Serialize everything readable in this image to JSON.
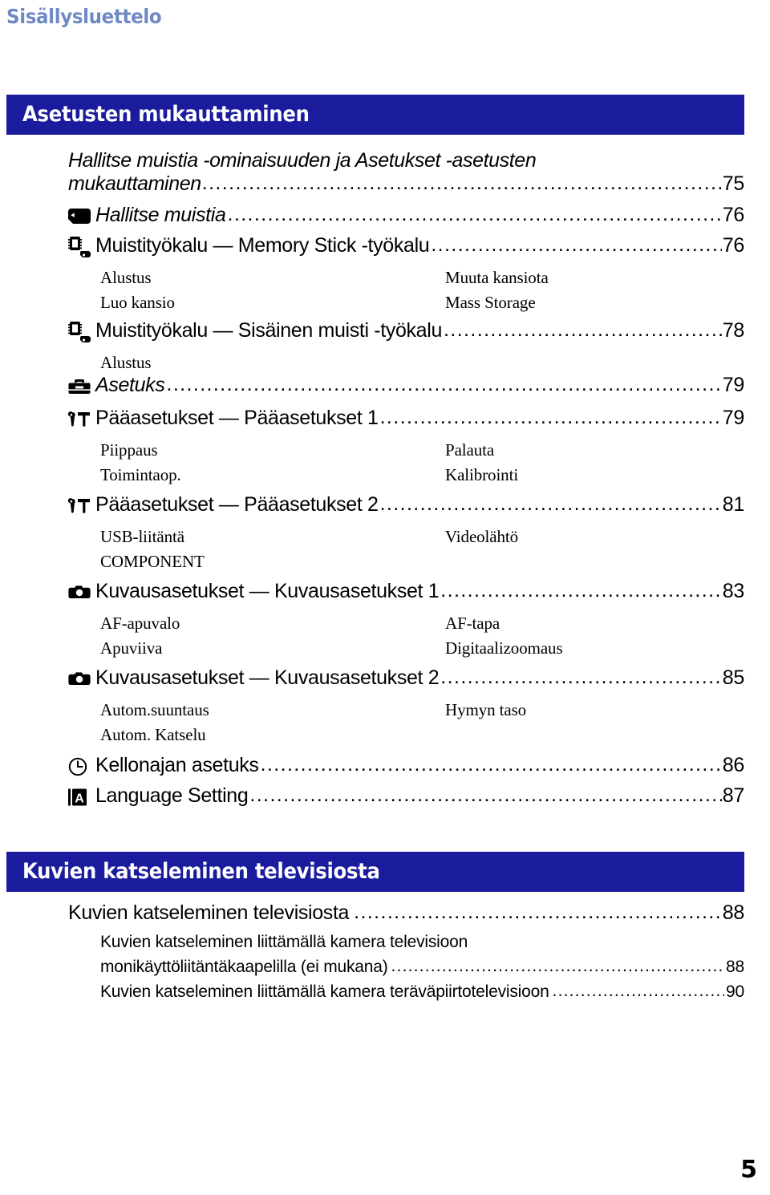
{
  "running_head": "Sisällysluettelo",
  "folio": "5",
  "colors": {
    "banner_blue": "#1b1b9e",
    "running_head_blue": "#7089c4",
    "text": "#000000"
  },
  "sections": [
    {
      "banner": "Asetusten mukauttaminen",
      "entries": [
        {
          "icon": "none",
          "label_line1": "Hallitse muistia -ominaisuuden ja Asetukset -asetusten",
          "label_line2": "mukauttaminen",
          "page": "75",
          "style": "italic"
        },
        {
          "icon": "memory-stick-icon",
          "label": "Hallitse muistia",
          "page": "76",
          "style": "italic"
        },
        {
          "icon": "memory-stick-tool-icon",
          "label": "Muistityökalu — Memory Stick -työkalu",
          "page": "76",
          "style": "regular",
          "subitems": [
            {
              "left": "Alustus",
              "right": "Muuta kansiota"
            },
            {
              "left": "Luo kansio",
              "right": "Mass Storage"
            }
          ]
        },
        {
          "icon": "internal-memory-tool-icon",
          "label": "Muistityökalu — Sisäinen muisti -työkalu",
          "page": "78",
          "style": "regular",
          "subitems": [
            {
              "left": "Alustus",
              "right": ""
            }
          ]
        },
        {
          "icon": "toolbox-icon",
          "label": "Asetuks",
          "page": "79",
          "style": "italic"
        },
        {
          "icon": "wrench-hammer-icon",
          "label": "Pääasetukset — Pääasetukset 1",
          "page": "79",
          "style": "regular",
          "subitems": [
            {
              "left": "Piippaus",
              "right": "Palauta"
            },
            {
              "left": "Toimintaop.",
              "right": "Kalibrointi"
            }
          ]
        },
        {
          "icon": "wrench-hammer-icon",
          "label": "Pääasetukset — Pääasetukset 2",
          "page": "81",
          "style": "regular",
          "subitems": [
            {
              "left": "USB-liitäntä",
              "right": "Videolähtö"
            },
            {
              "left": "COMPONENT",
              "right": ""
            }
          ]
        },
        {
          "icon": "camera-icon",
          "label": "Kuvausasetukset — Kuvausasetukset 1",
          "page": "83",
          "style": "regular",
          "subitems": [
            {
              "left": "AF-apuvalo",
              "right": "AF-tapa"
            },
            {
              "left": "Apuviiva",
              "right": "Digitaalizoomaus"
            }
          ]
        },
        {
          "icon": "camera-icon",
          "label": "Kuvausasetukset — Kuvausasetukset 2",
          "page": "85",
          "style": "regular",
          "subitems": [
            {
              "left": "Autom.suuntaus",
              "right": "Hymyn taso"
            },
            {
              "left": "Autom. Katselu",
              "right": ""
            }
          ]
        },
        {
          "icon": "clock-icon",
          "label": "Kellonajan asetuks",
          "page": "86",
          "style": "regular"
        },
        {
          "icon": "language-a-icon",
          "label": "Language Setting",
          "page": "87",
          "style": "regular"
        }
      ]
    },
    {
      "banner": "Kuvien katseleminen televisiosta",
      "entries": [
        {
          "icon": "none",
          "label": "Kuvien katseleminen televisiosta",
          "page": "88",
          "style": "regular"
        }
      ],
      "subentries": [
        {
          "label": "Kuvien katseleminen liittämällä kamera televisioon",
          "page": "",
          "leaders": false
        },
        {
          "label": "monikäyttöliitäntäkaapelilla (ei mukana)",
          "page": "88",
          "leaders": true
        },
        {
          "label": "Kuvien katseleminen liittämällä kamera teräväpiirtotelevisioon",
          "page": "90",
          "leaders": true
        }
      ]
    }
  ],
  "leader_dots": "........................................................................................................................................................"
}
